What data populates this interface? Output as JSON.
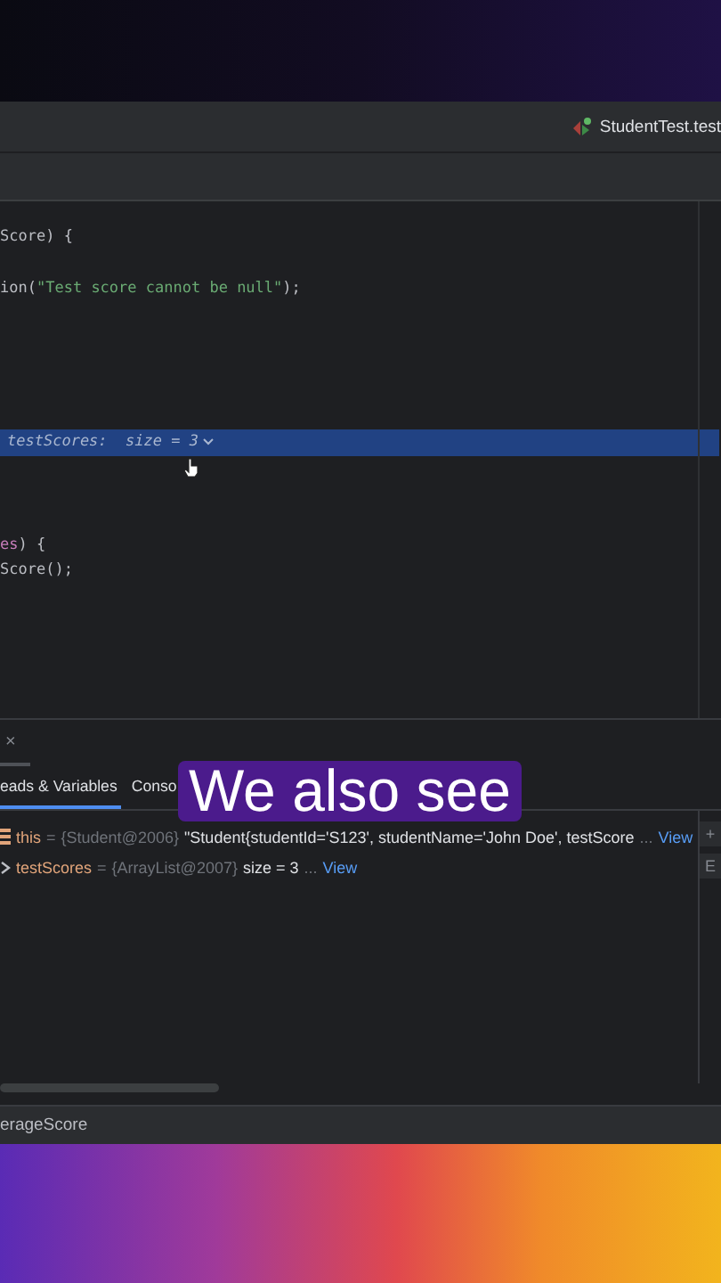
{
  "header": {
    "run_config": "StudentTest.test"
  },
  "editor": {
    "lines": [
      {
        "kind": "code",
        "parts": [
          {
            "kind": "plain",
            "text": "Score) {"
          }
        ]
      },
      {
        "kind": "blank"
      },
      {
        "kind": "code",
        "parts": [
          {
            "kind": "plain",
            "text": "ion("
          },
          {
            "kind": "string",
            "text": "\"Test score cannot be null\""
          },
          {
            "kind": "plain",
            "text": ");"
          }
        ]
      },
      {
        "kind": "blank"
      },
      {
        "kind": "blank"
      },
      {
        "kind": "blank"
      },
      {
        "kind": "blank"
      },
      {
        "kind": "blank"
      },
      {
        "kind": "inline_value",
        "parts": [
          {
            "kind": "hint",
            "text": "testScores:  size = 3"
          }
        ]
      },
      {
        "kind": "blank"
      },
      {
        "kind": "blank"
      },
      {
        "kind": "blank"
      },
      {
        "kind": "code",
        "parts": [
          {
            "kind": "field",
            "text": "es"
          },
          {
            "kind": "plain",
            "text": ") {"
          }
        ]
      },
      {
        "kind": "code",
        "parts": [
          {
            "kind": "plain",
            "text": "Score();"
          }
        ]
      }
    ]
  },
  "debug_panel": {
    "close": "×",
    "tabs": [
      {
        "label": "eads & Variables",
        "selected": true
      },
      {
        "label": "Conso",
        "selected": false
      }
    ],
    "variables": [
      {
        "kind": "object",
        "name": "this",
        "equals": "=",
        "type": "{Student@2006}",
        "value": "\"Student{studentId='S123', studentName='John Doe', testScore",
        "more": "...",
        "link": "View"
      },
      {
        "kind": "list",
        "name": "testScores",
        "equals": "=",
        "type": "{ArrayList@2007}",
        "value": "size = 3",
        "more": "...",
        "link": "View"
      }
    ],
    "side_buttons": [
      "+",
      "E"
    ]
  },
  "status_bar": {
    "breadcrumb": "erageScore"
  },
  "caption": "We also see"
}
